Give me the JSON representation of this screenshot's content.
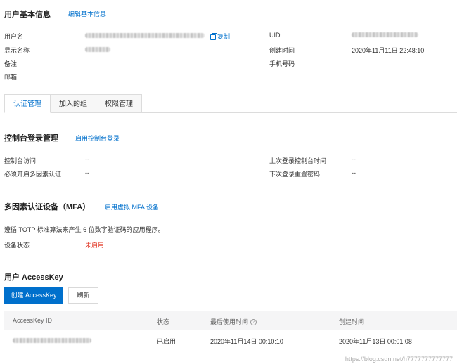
{
  "basic_info": {
    "title": "用户基本信息",
    "edit_link": "编辑基本信息",
    "copy_label": "复制",
    "labels": {
      "username": "用户名",
      "display_name": "显示名称",
      "remark": "备注",
      "email": "邮箱",
      "uid": "UID",
      "created_time": "创建时间",
      "phone": "手机号码"
    },
    "values": {
      "created_time": "2020年11月11日 22:48:10"
    }
  },
  "tabs": [
    {
      "label": "认证管理",
      "active": true
    },
    {
      "label": "加入的组",
      "active": false
    },
    {
      "label": "权限管理",
      "active": false
    }
  ],
  "console_login": {
    "title": "控制台登录管理",
    "enable_link": "启用控制台登录",
    "console_access_label": "控制台访问",
    "console_access_value": "--",
    "mfa_required_label": "必须开启多因素认证",
    "mfa_required_value": "--",
    "last_login_label": "上次登录控制台时间",
    "last_login_value": "--",
    "next_reset_label": "下次登录重置密码",
    "next_reset_value": "--"
  },
  "mfa": {
    "title": "多因素认证设备（MFA）",
    "enable_link": "启用虚拟 MFA 设备",
    "description": "遵循 TOTP 标准算法来产生 6 位数字验证码的应用程序。",
    "status_label": "设备状态",
    "status_value": "未启用"
  },
  "accesskey": {
    "title": "用户 AccessKey",
    "create_button": "创建 AccessKey",
    "refresh_button": "刷新",
    "columns": {
      "id": "AccessKey ID",
      "status": "状态",
      "last_used": "最后使用时间",
      "help": "?",
      "created": "创建时间"
    },
    "rows": [
      {
        "status": "已启用",
        "last_used": "2020年11月14日 00:10:10",
        "created": "2020年11月13日 00:01:08"
      }
    ]
  },
  "watermark": "https://blog.csdn.net/h7777777777777",
  "colors": {
    "accent": "#0070cc",
    "danger": "#e0301e"
  }
}
